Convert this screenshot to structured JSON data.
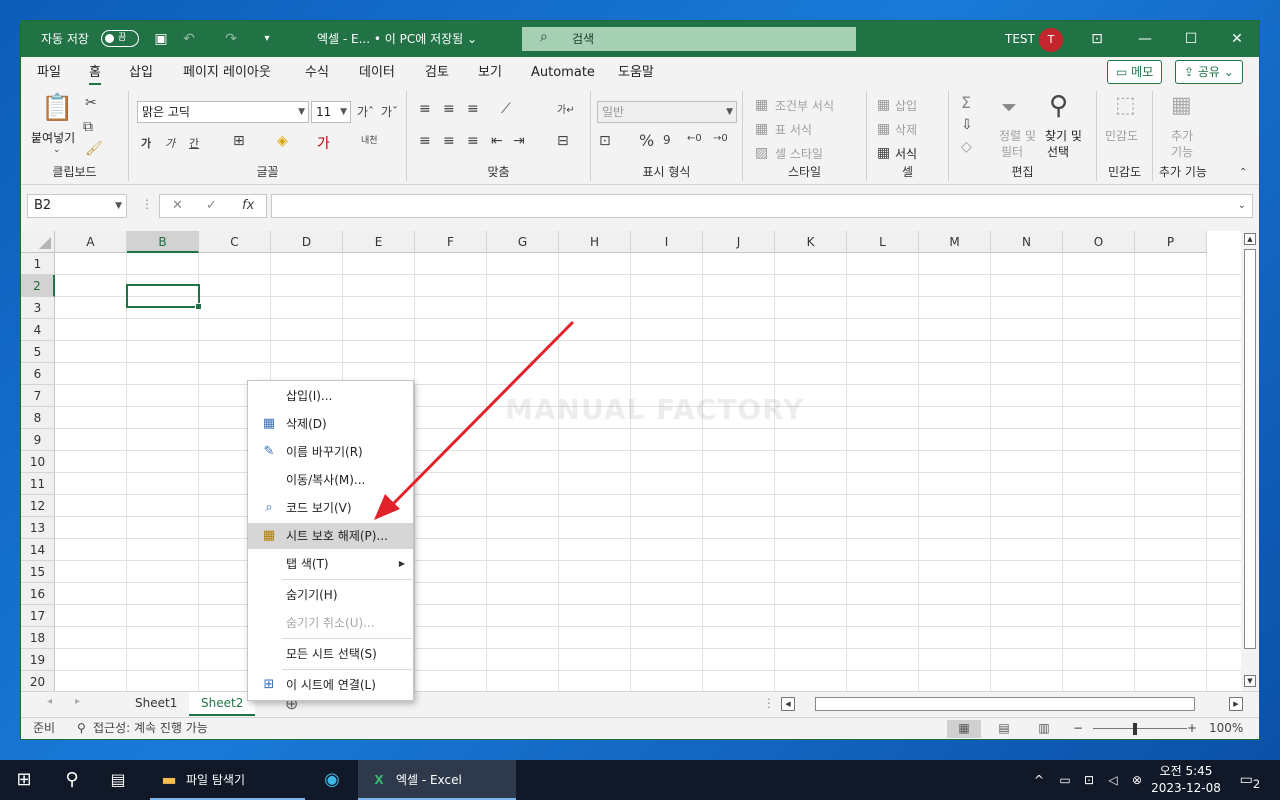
{
  "titlebar": {
    "autosave_label": "자동 저장",
    "autosave_state": "끔",
    "doc_title": "엑셀 - E... • 이 PC에 저장됨 ⌄",
    "search_placeholder": "검색",
    "user_name": "TEST",
    "avatar_initial": "T"
  },
  "menu_tabs": [
    "파일",
    "홈",
    "삽입",
    "페이지 레이아웃",
    "수식",
    "데이터",
    "검토",
    "보기",
    "Automate",
    "도움말"
  ],
  "active_tab": "홈",
  "menu_buttons": {
    "memo": "메모",
    "share": "공유"
  },
  "ribbon": {
    "clipboard": {
      "label": "클립보드",
      "paste": "붙여넣기"
    },
    "font": {
      "label": "글꼴",
      "font_name": "맑은 고딕",
      "font_size": "11"
    },
    "alignment": {
      "label": "맞춤"
    },
    "number": {
      "label": "표시 형식",
      "format": "일반"
    },
    "styles": {
      "label": "스타일",
      "conditional": "조건부 서식",
      "table": "표 서식",
      "cell_styles": "셀 스타일"
    },
    "cells": {
      "label": "셀",
      "insert": "삽입",
      "delete": "삭제",
      "format": "서식"
    },
    "editing": {
      "label": "편집",
      "sort_filter_1": "정렬 및",
      "sort_filter_2": "필터",
      "find_1": "찾기 및",
      "find_2": "선택"
    },
    "sensitivity": {
      "label": "민감도",
      "button": "민감도"
    },
    "addins": {
      "label": "추가 기능",
      "button_1": "추가",
      "button_2": "기능"
    }
  },
  "formula_bar": {
    "name_box": "B2",
    "fx": "fx",
    "formula": ""
  },
  "columns": [
    "A",
    "B",
    "C",
    "D",
    "E",
    "F",
    "G",
    "H",
    "I",
    "J",
    "K",
    "L",
    "M",
    "N",
    "O",
    "P"
  ],
  "rows": [
    "1",
    "2",
    "3",
    "4",
    "5",
    "6",
    "7",
    "8",
    "9",
    "10",
    "11",
    "12",
    "13",
    "14",
    "15",
    "16",
    "17",
    "18",
    "19",
    "20"
  ],
  "selected_cell": "B2",
  "watermark": "MANUAL FACTORY",
  "sheets": [
    "Sheet1",
    "Sheet2"
  ],
  "active_sheet": "Sheet2",
  "context_menu": [
    {
      "label": "삽입(I)...",
      "icon": "",
      "enabled": true
    },
    {
      "label": "삭제(D)",
      "icon": "delete-sheet-icon",
      "enabled": true
    },
    {
      "label": "이름 바꾸기(R)",
      "icon": "rename-sheet-icon",
      "enabled": true
    },
    {
      "label": "이동/복사(M)...",
      "icon": "",
      "enabled": true
    },
    {
      "label": "코드 보기(V)",
      "icon": "view-code-icon",
      "enabled": true
    },
    {
      "label": "시트 보호 해제(P)...",
      "icon": "unprotect-sheet-icon",
      "enabled": true,
      "highlighted": true
    },
    {
      "label": "탭 색(T)",
      "icon": "",
      "enabled": true,
      "submenu": true
    },
    {
      "label": "숨기기(H)",
      "icon": "",
      "enabled": true
    },
    {
      "label": "숨기기 취소(U)...",
      "icon": "",
      "enabled": false
    },
    {
      "label": "모든 시트 선택(S)",
      "icon": "",
      "enabled": true
    },
    {
      "label": "이 시트에 연결(L)",
      "icon": "link-sheet-icon",
      "enabled": true
    }
  ],
  "statusbar": {
    "ready": "준비",
    "accessibility": "접근성: 계속 진행 가능",
    "zoom": "100%"
  },
  "taskbar": {
    "explorer": "파일 탐색기",
    "excel": "엑셀 - Excel",
    "time": "오전 5:45",
    "date": "2023-12-08",
    "notifications": "2"
  },
  "colors": {
    "excel_green": "#217346",
    "annotation_arrow": "#e2222a"
  }
}
